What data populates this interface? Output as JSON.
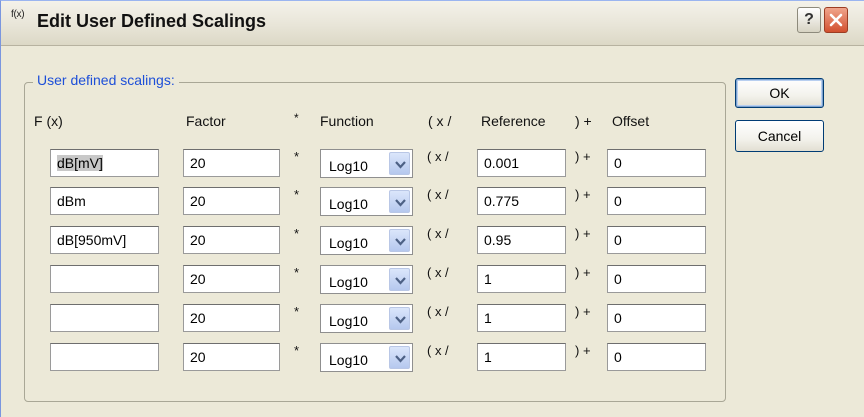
{
  "window": {
    "title": "Edit User Defined Scalings",
    "app_icon_text": "f(x)"
  },
  "group": {
    "label": "User defined scalings:"
  },
  "headers": {
    "fx": "F (x)",
    "factor": "Factor",
    "times": "*",
    "function": "Function",
    "open": "( x /",
    "reference": "Reference",
    "close": ") +",
    "offset": "Offset"
  },
  "symbols": {
    "times": "*",
    "open": "( x /",
    "close": ") +"
  },
  "rows": [
    {
      "fx": "dB[mV]",
      "factor": "20",
      "function": "Log10",
      "reference": "0.001",
      "offset": "0"
    },
    {
      "fx": "dBm",
      "factor": "20",
      "function": "Log10",
      "reference": "0.775",
      "offset": "0"
    },
    {
      "fx": "dB[950mV]",
      "factor": "20",
      "function": "Log10",
      "reference": "0.95",
      "offset": "0"
    },
    {
      "fx": "",
      "factor": "20",
      "function": "Log10",
      "reference": "1",
      "offset": "0"
    },
    {
      "fx": "",
      "factor": "20",
      "function": "Log10",
      "reference": "1",
      "offset": "0"
    },
    {
      "fx": "",
      "factor": "20",
      "function": "Log10",
      "reference": "1",
      "offset": "0"
    }
  ],
  "buttons": {
    "ok": "OK",
    "cancel": "Cancel",
    "help": "?"
  }
}
